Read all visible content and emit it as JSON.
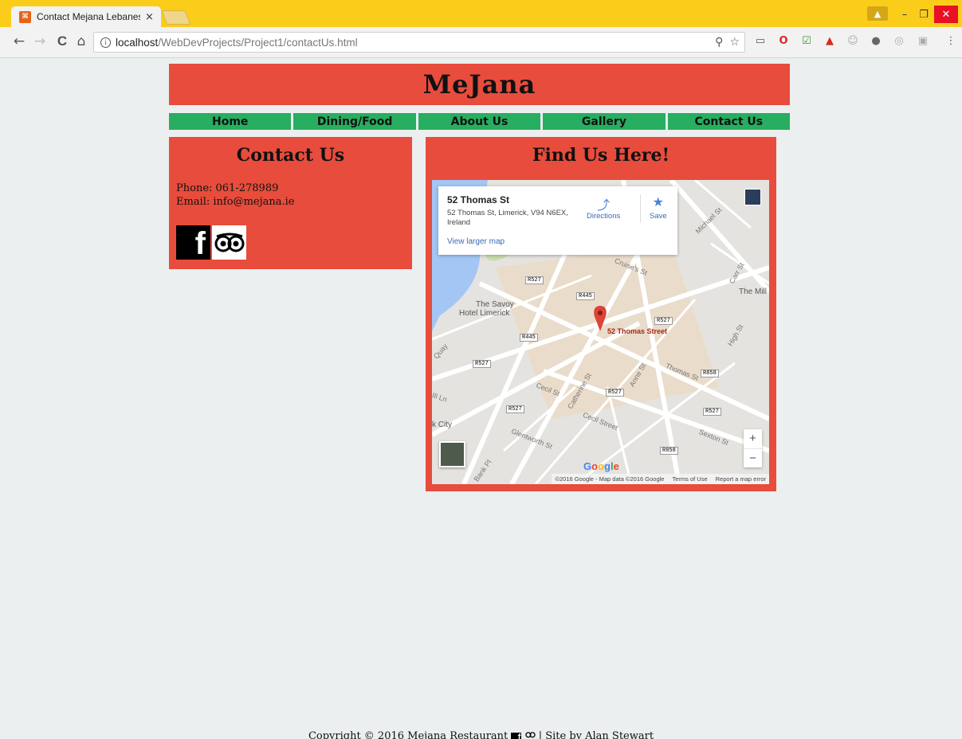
{
  "browser": {
    "tab_title": "Contact Mejana Lebanes",
    "tab_close": "×",
    "url_host": "localhost",
    "url_path": "/WebDevProjects/Project1/contactUs.html",
    "back": "←",
    "forward": "→",
    "reload": "C",
    "home": "⌂",
    "menu": "⋮"
  },
  "site": {
    "logo": "MeJana",
    "nav": [
      "Home",
      "Dining/Food",
      "About Us",
      "Gallery",
      "Contact Us"
    ],
    "contact": {
      "heading": "Contact Us",
      "phone": "Phone: 061-278989",
      "email": "Email: info@mejana.ie"
    },
    "findus": {
      "heading": "Find Us Here!"
    },
    "footer": {
      "left": "Copyright © 2016 Mejana Restaurant",
      "right": "| Site by Alan Stewart"
    }
  },
  "map": {
    "card_title": "52 Thomas St",
    "card_address": "52 Thomas St, Limerick, V94 N6EX, Ireland",
    "directions": "Directions",
    "save": "Save",
    "larger_map": "View larger map",
    "pin_label": "52 Thomas Street",
    "labels": [
      "The Savoy",
      "Hotel Limerick",
      "The Mill",
      "Cruise's St",
      "Thomas St",
      "Cecil St",
      "Cecil Street",
      "Glentworth St",
      "Sexton St",
      "High St",
      "Carr St",
      "Catherine St",
      "Anne St",
      "Michael St",
      "k City",
      "Ill Ln",
      "Quay",
      "Bank Pl"
    ],
    "roads": [
      "R527",
      "R445",
      "R527",
      "R445",
      "R527",
      "R527",
      "R527",
      "R858",
      "R527",
      "R858"
    ],
    "google": "Google",
    "footer_copy": "©2016 Google - Map data ©2016 Google",
    "terms": "Terms of Use",
    "report": "Report a map error",
    "zoom_in": "+",
    "zoom_out": "−"
  },
  "colors": {
    "accent_red": "#e74c3c",
    "nav_green": "#27ae60",
    "chrome_yellow": "#fbcd1b"
  }
}
